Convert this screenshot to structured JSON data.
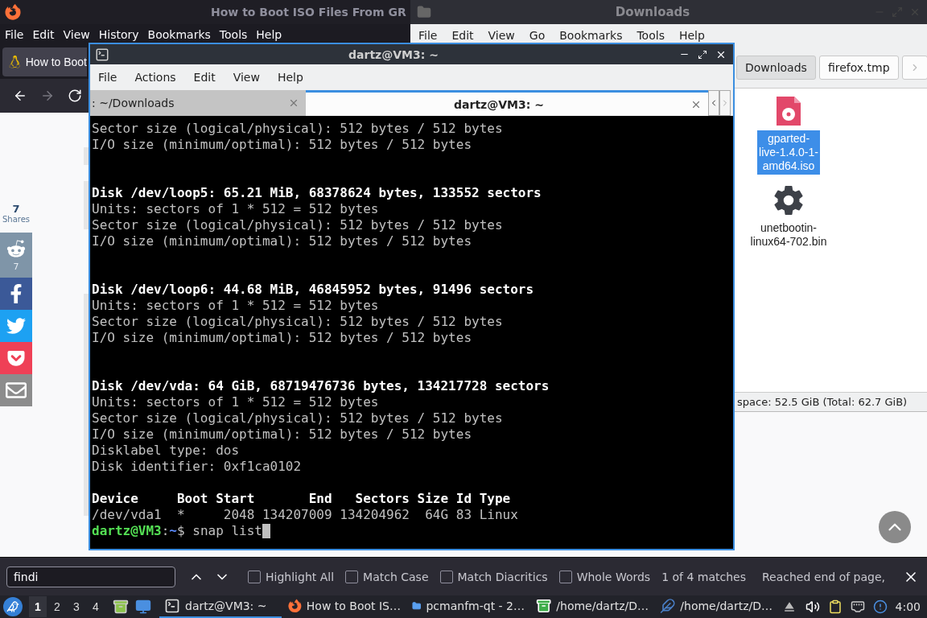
{
  "browser": {
    "title": "How to Boot ISO Files From GR",
    "menu": [
      "File",
      "Edit",
      "View",
      "History",
      "Bookmarks",
      "Tools",
      "Help"
    ],
    "tab": {
      "title": "How to Boot"
    },
    "share": {
      "count": "7",
      "label": "Shares",
      "buttons": [
        {
          "kind": "reddit",
          "count": "7"
        },
        {
          "kind": "facebook"
        },
        {
          "kind": "twitter"
        },
        {
          "kind": "pocket"
        },
        {
          "kind": "email"
        }
      ]
    },
    "page_fragments": [
      {
        "kind": "code"
      },
      {
        "kind": "block"
      },
      {
        "kind": "tallblock"
      }
    ],
    "find_bar": {
      "query": "findi",
      "options": [
        {
          "label": "Highlight All",
          "checked": false
        },
        {
          "label": "Match Case",
          "checked": false
        },
        {
          "label": "Match Diacritics",
          "checked": false
        },
        {
          "label": "Whole Words",
          "checked": false
        }
      ],
      "status": "1 of 4 matches",
      "message": "Reached end of page,"
    }
  },
  "file_manager": {
    "title": "Downloads",
    "menu": [
      "File",
      "Edit",
      "View",
      "Go",
      "Bookmarks",
      "Tools",
      "Help"
    ],
    "path_buttons": [
      {
        "label": "Downloads",
        "selected": true
      },
      {
        "label": "firefox.tmp",
        "selected": false
      }
    ],
    "files": [
      {
        "name_lines": [
          "gparted-",
          "live-1.4.0-1-",
          "amd64.iso"
        ],
        "kind": "iso",
        "selected": true
      },
      {
        "name_lines": [
          "unetbootin-",
          "linux64-702.bin"
        ],
        "kind": "binary",
        "selected": false
      }
    ],
    "status": "space: 52.5 GiB (Total: 62.7 GiB)"
  },
  "terminal": {
    "title": "dartz@VM3: ~",
    "menu": [
      "File",
      "Actions",
      "Edit",
      "View",
      "Help"
    ],
    "tabs": [
      {
        "label": ": ~/Downloads",
        "selected": false
      },
      {
        "label": "dartz@VM3: ~",
        "selected": true
      }
    ],
    "lines": [
      {
        "kind": "normal",
        "text": "Sector size (logical/physical): 512 bytes / 512 bytes"
      },
      {
        "kind": "normal",
        "text": "I/O size (minimum/optimal): 512 bytes / 512 bytes"
      },
      {
        "kind": "blank"
      },
      {
        "kind": "blank"
      },
      {
        "kind": "bold",
        "text": "Disk /dev/loop5: 65.21 MiB, 68378624 bytes, 133552 sectors"
      },
      {
        "kind": "normal",
        "text": "Units: sectors of 1 * 512 = 512 bytes"
      },
      {
        "kind": "normal",
        "text": "Sector size (logical/physical): 512 bytes / 512 bytes"
      },
      {
        "kind": "normal",
        "text": "I/O size (minimum/optimal): 512 bytes / 512 bytes"
      },
      {
        "kind": "blank"
      },
      {
        "kind": "blank"
      },
      {
        "kind": "bold",
        "text": "Disk /dev/loop6: 44.68 MiB, 46845952 bytes, 91496 sectors"
      },
      {
        "kind": "normal",
        "text": "Units: sectors of 1 * 512 = 512 bytes"
      },
      {
        "kind": "normal",
        "text": "Sector size (logical/physical): 512 bytes / 512 bytes"
      },
      {
        "kind": "normal",
        "text": "I/O size (minimum/optimal): 512 bytes / 512 bytes"
      },
      {
        "kind": "blank"
      },
      {
        "kind": "blank"
      },
      {
        "kind": "bold",
        "text": "Disk /dev/vda: 64 GiB, 68719476736 bytes, 134217728 sectors"
      },
      {
        "kind": "normal",
        "text": "Units: sectors of 1 * 512 = 512 bytes"
      },
      {
        "kind": "normal",
        "text": "Sector size (logical/physical): 512 bytes / 512 bytes"
      },
      {
        "kind": "normal",
        "text": "I/O size (minimum/optimal): 512 bytes / 512 bytes"
      },
      {
        "kind": "normal",
        "text": "Disklabel type: dos"
      },
      {
        "kind": "normal",
        "text": "Disk identifier: 0xf1ca0102"
      },
      {
        "kind": "blank"
      },
      {
        "kind": "bold",
        "text": "Device     Boot Start       End   Sectors Size Id Type"
      },
      {
        "kind": "normal",
        "text": "/dev/vda1  *     2048 134207009 134204962  64G 83 Linux"
      }
    ],
    "prompt": {
      "user_host": "dartz@VM3",
      "separator": ":",
      "path": "~",
      "symbol": "$",
      "command": "snap list"
    }
  },
  "taskbar": {
    "desktops": [
      {
        "label": "1",
        "selected": true
      },
      {
        "label": "2",
        "selected": false
      },
      {
        "label": "3",
        "selected": false
      },
      {
        "label": "4",
        "selected": false
      }
    ],
    "tasks": [
      {
        "kind": "terminal",
        "label": "dartz@VM3: ~",
        "selected": true
      },
      {
        "kind": "firefox",
        "label": "How to Boot IS…",
        "selected": false
      },
      {
        "kind": "folder",
        "label": "pcmanfm-qt - 2…",
        "selected": false
      },
      {
        "kind": "archive",
        "label": "/home/dartz/D…",
        "selected": false
      },
      {
        "kind": "editor",
        "label": "/home/dartz/D…",
        "selected": false
      }
    ],
    "clock": "4:00"
  }
}
